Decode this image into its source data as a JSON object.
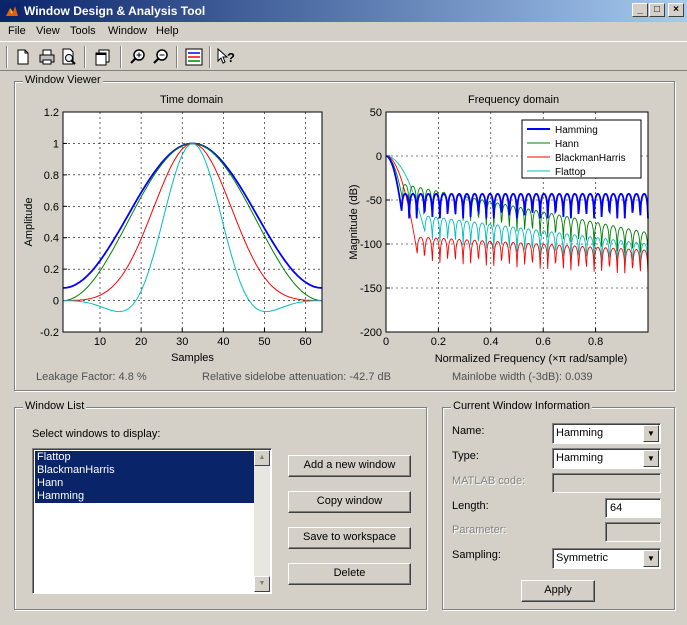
{
  "window": {
    "title": "Window Design & Analysis Tool",
    "minimize_glyph": "_",
    "maximize_glyph": "□",
    "close_glyph": "×"
  },
  "menu": {
    "items": [
      "File",
      "View",
      "Tools",
      "Window",
      "Help"
    ]
  },
  "toolbar": {
    "icons": [
      "new-icon",
      "print-icon",
      "print-preview-icon",
      "new-window-icon",
      "zoom-in-icon",
      "zoom-out-icon",
      "legend-icon",
      "whats-this-icon"
    ]
  },
  "window_viewer": {
    "group_title": "Window Viewer",
    "time_domain_title": "Time domain",
    "frequency_domain_title": "Frequency domain",
    "leakage_factor": "Leakage Factor: 4.8 %",
    "sidelobe_attenuation": "Relative sidelobe attenuation: -42.7 dB",
    "mainlobe_width": "Mainlobe width (-3dB): 0.039"
  },
  "chart_data": [
    {
      "type": "line",
      "title": "Time domain",
      "xlabel": "Samples",
      "ylabel": "Amplitude",
      "xlim": [
        1,
        64
      ],
      "ylim": [
        -0.2,
        1.2
      ],
      "xticks": [
        10,
        20,
        30,
        40,
        50,
        60
      ],
      "yticks": [
        -0.2,
        0,
        0.2,
        0.4,
        0.6,
        0.8,
        1,
        1.2
      ],
      "ytick_labels": [
        "-0.2",
        "0",
        "0.2",
        "0.4",
        "0.6",
        "0.8",
        "1",
        "1.2"
      ],
      "grid": true,
      "n_samples": 64,
      "series": [
        {
          "name": "Hamming",
          "color": "#0000ff",
          "window": "hamming"
        },
        {
          "name": "Hann",
          "color": "#008000",
          "window": "hann"
        },
        {
          "name": "BlackmanHarris",
          "color": "#ff0000",
          "window": "blackmanharris"
        },
        {
          "name": "Flattop",
          "color": "#00bfbf",
          "window": "flattop"
        }
      ]
    },
    {
      "type": "line",
      "title": "Frequency domain",
      "xlabel": "Normalized Frequency  (×π rad/sample)",
      "ylabel": "Magnitude (dB)",
      "xlim": [
        0,
        1
      ],
      "ylim": [
        -200,
        50
      ],
      "xticks": [
        0,
        0.2,
        0.4,
        0.6,
        0.8
      ],
      "yticks": [
        -200,
        -150,
        -100,
        -50,
        0,
        50
      ],
      "grid": true,
      "legend_position": "top-right",
      "series": [
        {
          "name": "Hamming",
          "color": "#0000ff",
          "sidelobe_level_db": -43,
          "sidelobe_rolloff_db": 0
        },
        {
          "name": "Hann",
          "color": "#008000",
          "sidelobe_level_db": -32,
          "sidelobe_rolloff_db": 55
        },
        {
          "name": "BlackmanHarris",
          "color": "#ff0000",
          "sidelobe_level_db": -92,
          "sidelobe_rolloff_db": 15
        },
        {
          "name": "Flattop",
          "color": "#00bfbf",
          "sidelobe_level_db": -68,
          "sidelobe_rolloff_db": 32
        }
      ]
    }
  ],
  "window_list": {
    "group_title": "Window List",
    "prompt": "Select windows to display:",
    "items": [
      "Flattop",
      "BlackmanHarris",
      "Hann",
      "Hamming"
    ],
    "buttons": {
      "add": "Add a new window",
      "copy": "Copy window",
      "save": "Save to workspace",
      "delete": "Delete"
    }
  },
  "current_window": {
    "group_title": "Current Window Information",
    "name_label": "Name:",
    "name_value": "Hamming",
    "type_label": "Type:",
    "type_value": "Hamming",
    "matlab_code_label": "MATLAB code:",
    "matlab_code_value": "",
    "length_label": "Length:",
    "length_value": "64",
    "parameter_label": "Parameter:",
    "parameter_value": "",
    "sampling_label": "Sampling:",
    "sampling_value": "Symmetric",
    "apply_label": "Apply"
  }
}
